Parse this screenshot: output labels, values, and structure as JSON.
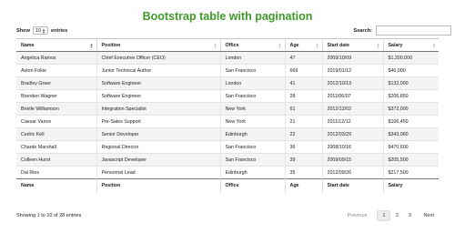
{
  "page_title": "Bootstrap table with pagination",
  "length_menu": {
    "show_label": "Show",
    "selected": "10",
    "entries_label": "entries"
  },
  "search": {
    "label": "Search:",
    "value": "",
    "placeholder": ""
  },
  "columns": [
    "Name",
    "Position",
    "Office",
    "Age",
    "Start date",
    "Salary"
  ],
  "rows": [
    [
      "Angelica Ramos",
      "Chief Executive Officer (CEO)",
      "London",
      "47",
      "2009/10/09",
      "$1,200,000"
    ],
    [
      "Aston Frikie",
      "Junior Technical Author",
      "San Francisco",
      "669",
      "2019/01/12",
      "$46,000"
    ],
    [
      "Bradley Greer",
      "Software Engineer",
      "London",
      "41",
      "2012/10/13",
      "$132,000"
    ],
    [
      "Brenden Wagner",
      "Software Engineer",
      "San Francisco",
      "28",
      "2011/06/07",
      "$206,850"
    ],
    [
      "Brielle Williamson",
      "Integration Specialist",
      "New York",
      "61",
      "2012/12/02",
      "$372,000"
    ],
    [
      "Caesar Vance",
      "Pre-Sales Support",
      "New York",
      "21",
      "2011/12/12",
      "$106,450"
    ],
    [
      "Cedric Kell",
      "Senior Developer",
      "Edinburgh",
      "22",
      "2012/03/29",
      "$343,060"
    ],
    [
      "Charde Marshall",
      "Regional Director",
      "San Francisco",
      "36",
      "2008/10/16",
      "$470,600"
    ],
    [
      "Colleen Hurst",
      "Javascript Developer",
      "San Francisco",
      "39",
      "2009/09/15",
      "$205,500"
    ],
    [
      "Dai Rios",
      "Personnel Lead",
      "Edinburgh",
      "35",
      "2012/09/26",
      "$217,500"
    ]
  ],
  "info_text": "Showing 1 to 10 of 28 entries",
  "pagination": {
    "previous": "Previous",
    "pages": [
      "1",
      "2",
      "3"
    ],
    "current": "1",
    "next": "Next"
  }
}
